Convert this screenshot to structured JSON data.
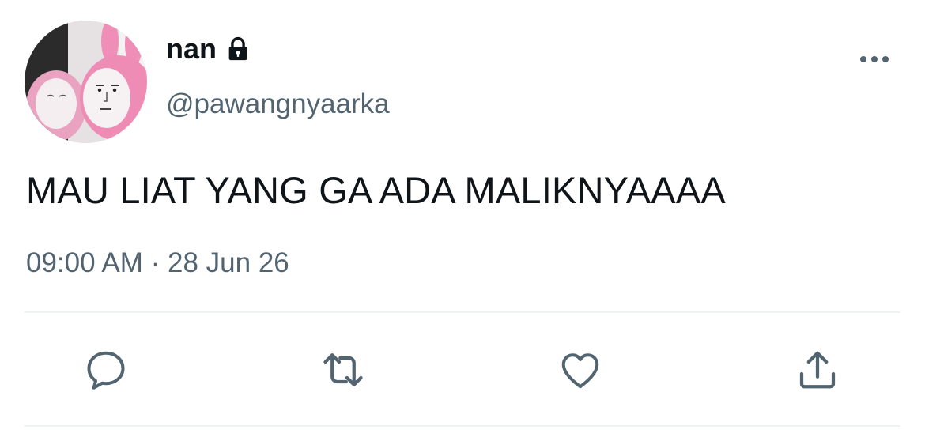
{
  "tweet": {
    "author": {
      "display_name": "nan",
      "handle": "@pawangnyaarka",
      "protected_icon": "lock-icon",
      "avatar": "pink-plush-avatar"
    },
    "text": "MAU LIAT YANG GA ADA MALIKNYAAAA",
    "time": "09:00 AM",
    "separator": "·",
    "date": "28 Jun 26",
    "menu_icon": "more-horizontal-icon"
  },
  "actions": [
    {
      "name": "reply",
      "icon": "reply-bubble-icon"
    },
    {
      "name": "retweet",
      "icon": "retweet-arrows-icon"
    },
    {
      "name": "like",
      "icon": "heart-icon"
    },
    {
      "name": "share",
      "icon": "share-upload-icon"
    }
  ],
  "colors": {
    "text_primary": "#0f1419",
    "text_secondary": "#536471",
    "divider": "#eff3f4",
    "icon": "#536471"
  }
}
